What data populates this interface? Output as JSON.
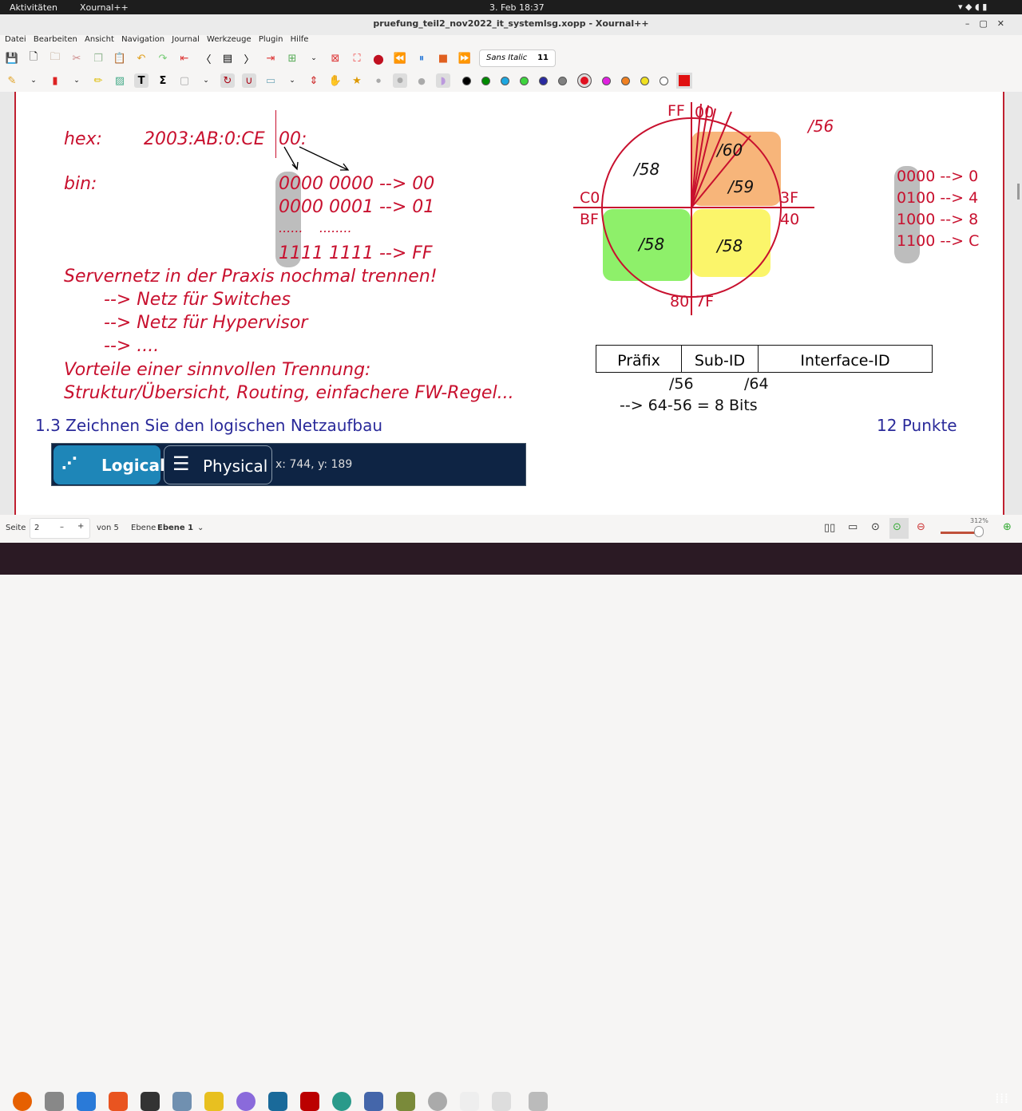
{
  "topbar": {
    "activities": "Aktivitäten",
    "app": "Xournal++",
    "datetime": "3. Feb 18:37"
  },
  "window": {
    "title": "pruefung_teil2_nov2022_it_systemlsg.xopp - Xournal++"
  },
  "menu": [
    "Datei",
    "Bearbeiten",
    "Ansicht",
    "Navigation",
    "Journal",
    "Werkzeuge",
    "Plugin",
    "Hilfe"
  ],
  "toolbar": {
    "font_name": "Sans Italic",
    "font_size": "11"
  },
  "colors": [
    "#000000",
    "#008a00",
    "#1ea7e0",
    "#3ed43e",
    "#2a2aa0",
    "#808080",
    "#e01020",
    "#e020e0",
    "#f08020",
    "#f0e020",
    "#ffffff"
  ],
  "note": {
    "hex_label": "hex:",
    "hex_value": "2003:AB:0:CE",
    "hex_tail": "00:",
    "bin_label": "bin:",
    "bin_lines": [
      "0000 0000 --> 00",
      "0000 0001 --> 01",
      "......    ........",
      "1111 1111 --> FF"
    ],
    "lines": [
      "Servernetz in der Praxis nochmal trennen!",
      "--> Netz für Switches",
      "--> Netz für Hypervisor",
      "--> ....",
      "Vorteile einer sinnvollen Trennung:",
      "Struktur/Übersicht, Routing, einfachere FW-Regel..."
    ],
    "map": [
      "0000 --> 0",
      "0100 --> 4",
      "1000 --> 8",
      "1100 --> C"
    ]
  },
  "diagram": {
    "ff": "FF",
    "z00": "00",
    "c0": "C0",
    "bf": "BF",
    "x3f": "3F",
    "x40": "40",
    "x80": "80",
    "x7f": "7F",
    "p56top": "/56",
    "q58a": "/58",
    "q60": "/60",
    "q59": "/59",
    "q58b": "/58",
    "q58c": "/58"
  },
  "table": {
    "cols": [
      "Präfix",
      "Sub-ID",
      "Interface-ID"
    ],
    "m56": "/56",
    "m64": "/64",
    "calc": "--> 64-56 = 8 Bits"
  },
  "task": {
    "title": "1.3 Zeichnen Sie den logischen Netzaufbau",
    "points": "12 Punkte"
  },
  "tabs": {
    "logical": "Logical",
    "physical": "Physical",
    "coords": "x: 744, y: 189"
  },
  "status": {
    "page_label": "Seite",
    "page": "2",
    "of": "von 5",
    "layer_label": "Ebene",
    "layer": "Ebene 1",
    "zoom": "312%"
  }
}
